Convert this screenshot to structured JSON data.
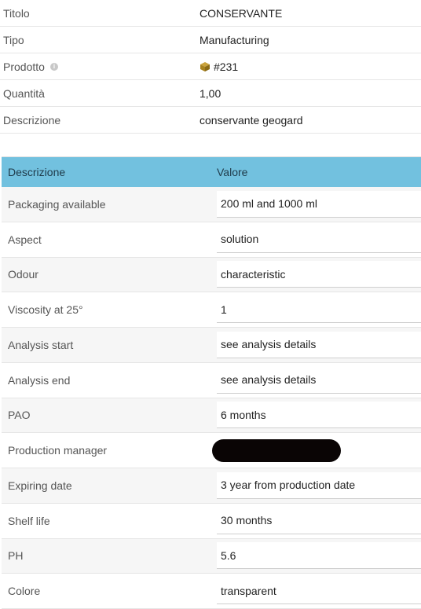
{
  "info": [
    {
      "label": "Titolo",
      "value": "CONSERVANTE"
    },
    {
      "label": "Tipo",
      "value": "Manufacturing"
    },
    {
      "label": "Prodotto",
      "value": "#231",
      "icon": "info-icon",
      "value_icon": "box-icon"
    },
    {
      "label": "Quantità",
      "value": "1,00"
    },
    {
      "label": "Descrizione",
      "value": "conservante geogard"
    }
  ],
  "table": {
    "header": {
      "col1": "Descrizione",
      "col2": "Valore"
    },
    "header_color": "#72c1df",
    "rows": [
      {
        "label": "Packaging available",
        "value": "200 ml and 1000 ml"
      },
      {
        "label": "Aspect",
        "value": "solution"
      },
      {
        "label": "Odour",
        "value": "characteristic"
      },
      {
        "label": "Viscosity at 25°",
        "value": "1"
      },
      {
        "label": "Analysis start",
        "value": "see analysis details"
      },
      {
        "label": "Analysis end",
        "value": "see analysis details"
      },
      {
        "label": "PAO",
        "value": "6 months"
      },
      {
        "label": "Production manager",
        "value": "",
        "redacted": true
      },
      {
        "label": "Expiring date",
        "value": "3 year from production date"
      },
      {
        "label": "Shelf life",
        "value": "30 months"
      },
      {
        "label": "PH",
        "value": "5.6"
      },
      {
        "label": "Colore",
        "value": "transparent"
      }
    ]
  }
}
